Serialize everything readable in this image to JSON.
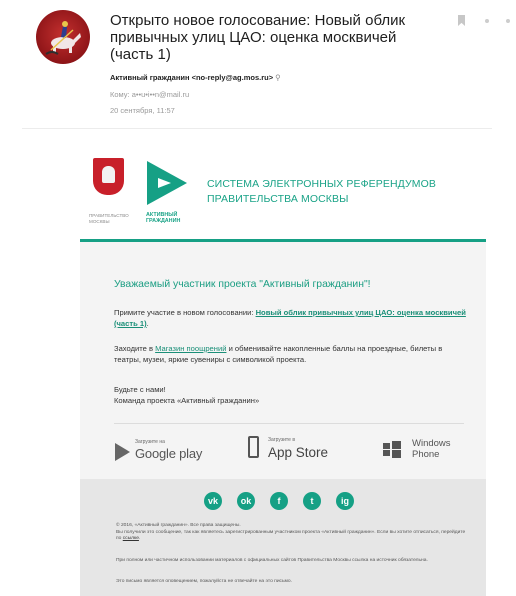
{
  "header": {
    "subject": "Открыто новое голосование: Новый облик привычных улиц ЦАО: оценка москвичей (часть 1)",
    "from": "Активный гражданин <no-reply@ag.mos.ru>",
    "to": "Кому: a••u•i••n@mail.ru",
    "date": "20 сентября, 11:57"
  },
  "icons": [
    "bookmark-icon",
    "dot-icon",
    "magnifier-icon",
    "vk-icon",
    "odnoklassniki-icon",
    "facebook-icon",
    "twitter-icon",
    "instagram-icon",
    "google-play-icon",
    "apple-icon",
    "windows-icon"
  ],
  "logo": {
    "gov_caption": "Правительство Москвы",
    "ag_caption": "Активный гражданин",
    "system_title": "Система электронных референдумов Правительства Москвы"
  },
  "body": {
    "greeting": "Уважаемый участник проекта \"Активный гражданин\"!",
    "invite_prefix": "Примите участие в новом голосовании: ",
    "poll_link": "Новый облик привычных улиц ЦАО: оценка москвичей (часть 1)",
    "invite_suffix": ".",
    "shop_prefix": "Заходите в ",
    "shop_link": "Магазин поощрений",
    "shop_suffix": " и обменивайте накопленные баллы на проездные, билеты в театры, музеи, яркие сувениры с символикой проекта.",
    "signoff_1": "Будьте с нами!",
    "signoff_2": "Команда проекта «Активный гражданин»"
  },
  "stores": {
    "google_small": "Загрузите на",
    "google_big": "Google play",
    "apple_small": "Загрузите в",
    "apple_big": "App Store",
    "windows_big_1": "Windows",
    "windows_big_2": "Phone"
  },
  "footer": {
    "social": [
      "vk",
      "ok",
      "f",
      "t",
      "ig"
    ],
    "copyright": "© 2016, «Активный гражданин». Все права защищены.",
    "received_line": "Вы получили это сообщение, так как являетесь зарегистрированным участником проекта «Активный гражданин». Если вы хотите отписаться, перейдите по ",
    "received_link": "ссылке",
    "received_end": ".",
    "reuse_line": "При полном или частичном использовании материалов с официальных сайтов Правительства Москвы ссылка на источник обязательна.",
    "notice_line": "Это письмо является оповещением, пожалуйста не отвечайте на это письмо."
  },
  "colors": {
    "accent_green": "#16a085",
    "avatar_red": "#a41c1f",
    "coat_red": "#c8202a"
  }
}
